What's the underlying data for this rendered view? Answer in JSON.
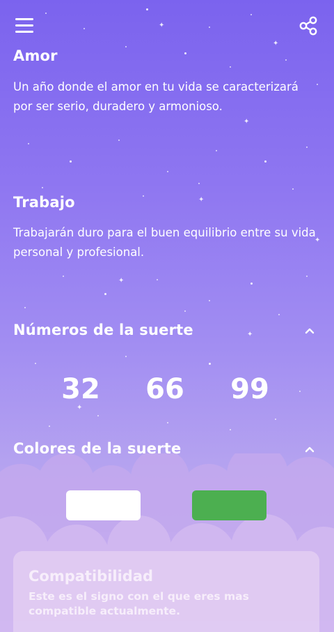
{
  "header": {
    "menu_icon": "hamburger-menu-icon",
    "share_icon": "share-icon"
  },
  "amor": {
    "title": "Amor",
    "text": "Un año donde el amor en tu vida se caracterizará por ser serio, duradero y armonioso."
  },
  "trabajo": {
    "title": "Trabajo",
    "text": "Trabajarán duro para el buen equilibrio entre su vida personal y profesional."
  },
  "lucky_numbers": {
    "title": "Números de la suerte",
    "values": [
      "32",
      "66",
      "99"
    ]
  },
  "lucky_colors": {
    "title": "Colores de la suerte",
    "swatches": [
      "#ffffff",
      "#4caf50"
    ]
  },
  "compatibility": {
    "title": "Compatibilidad",
    "text": "Este es el signo con el que eres mas compatible actualmente."
  },
  "colors": {
    "bg_top": "#7b63ee",
    "bg_bottom": "#c9b6ef",
    "cloud": "#c7acee"
  }
}
